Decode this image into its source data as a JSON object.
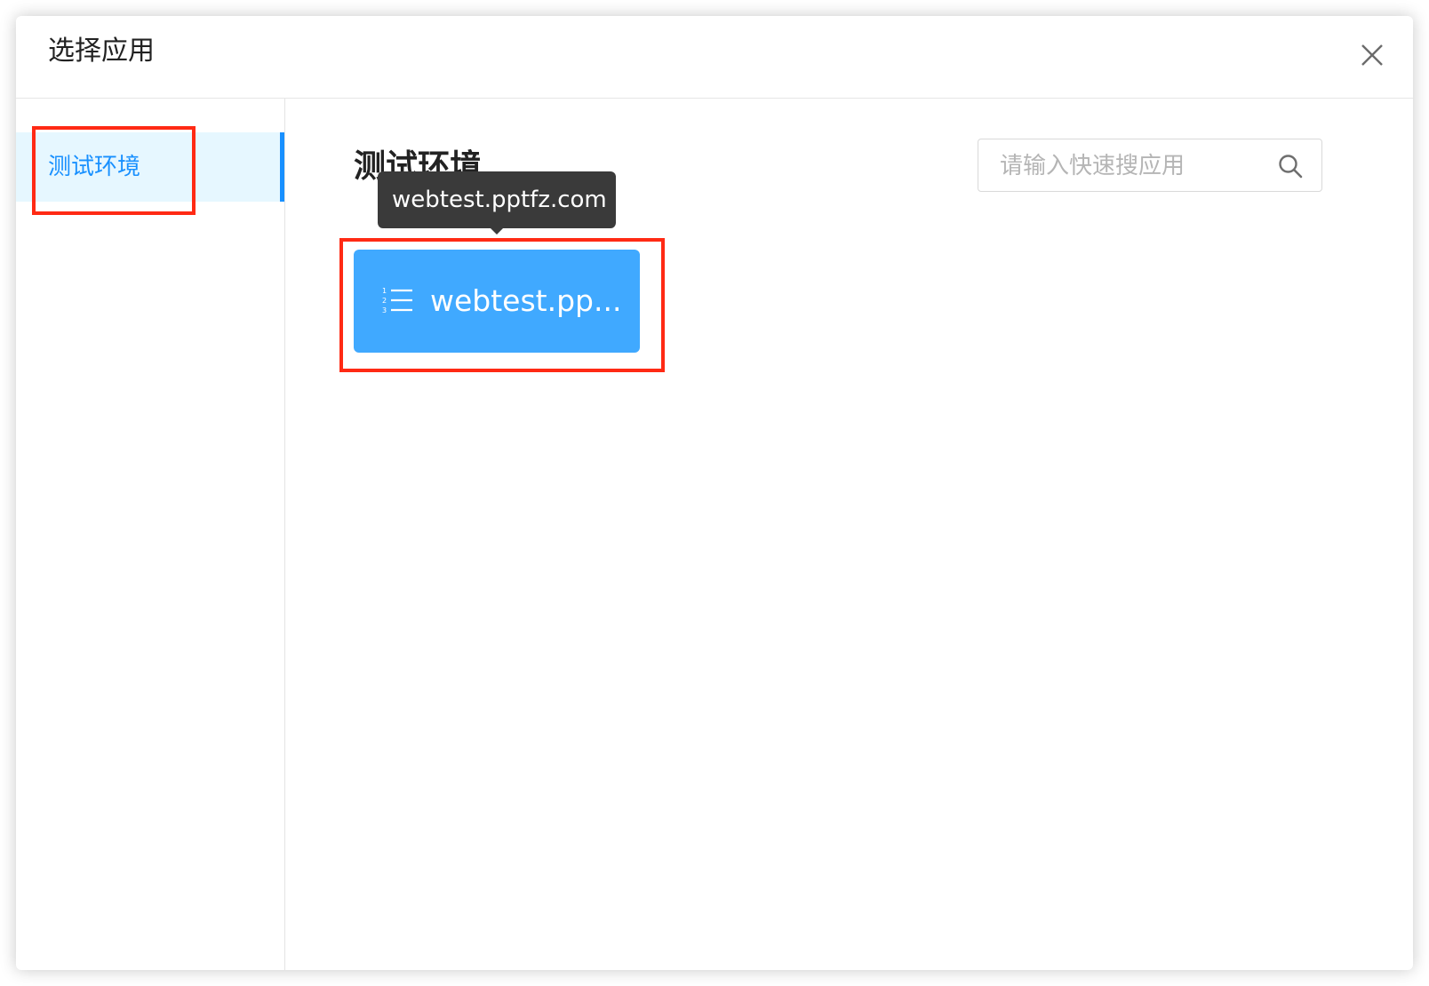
{
  "dialog": {
    "title": "选择应用",
    "close_icon": "close-icon"
  },
  "sidebar": {
    "items": [
      {
        "label": "测试环境",
        "active": true
      }
    ]
  },
  "main": {
    "section_title": "测试环境",
    "search": {
      "placeholder": "请输入快速搜应用",
      "value": "",
      "icon": "search-icon"
    },
    "apps": [
      {
        "label": "webtest.pp...",
        "icon": "ordered-list-icon"
      }
    ],
    "tooltip": {
      "text": "webtest.pptfz.com"
    }
  },
  "colors": {
    "accent": "#1890ff",
    "card": "#40a9ff",
    "highlight": "#ff2a14",
    "tooltip": "#3a3a3a"
  }
}
